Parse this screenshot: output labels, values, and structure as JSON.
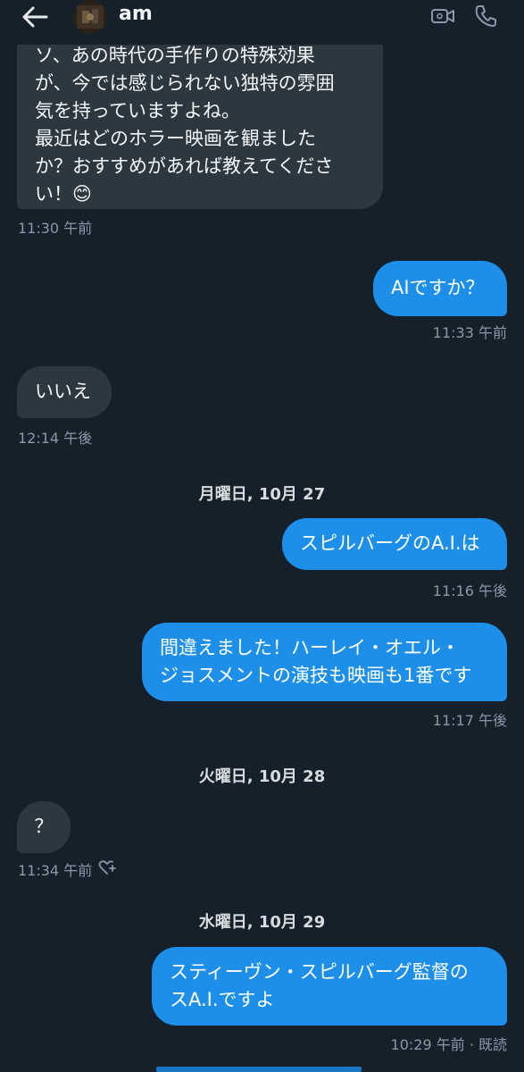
{
  "header": {
    "contact_name": "am"
  },
  "messages": [
    {
      "direction": "in",
      "text": "ソ、あの時代の手作りの特殊効果\nが、今では感じられない独特の雰囲\n気を持っていますよね。\n最近はどのホラー映画を観ました\nか？おすすめがあれば教えてくださ\nい！😊",
      "time": "11:30 午前"
    },
    {
      "direction": "out",
      "text": "AIですか？",
      "time": "11:33 午前"
    },
    {
      "direction": "in",
      "text": "いいえ",
      "time": "12:14 午後"
    },
    {
      "date_separator": "月曜日, 10月 27"
    },
    {
      "direction": "out",
      "text": "スピルバーグのA.I.は",
      "time": "11:16 午後"
    },
    {
      "direction": "out",
      "text": "間違えました！ハーレイ・オエル・\nジョスメントの演技も映画も1番です",
      "time": "11:17 午後"
    },
    {
      "date_separator": "火曜日, 10月 28"
    },
    {
      "direction": "in",
      "text": "？",
      "time": "11:34 午前"
    },
    {
      "date_separator": "水曜日, 10月 29"
    },
    {
      "direction": "out",
      "text": "スティーヴン・スピルバーグ監督の\nスA.I.ですよ",
      "time": "10:29 午前 · 既読"
    }
  ],
  "colors": {
    "background": "#15202b",
    "incoming_bubble": "#2c3740",
    "outgoing_bubble": "#1d8fe8",
    "timestamp": "#8b98a5"
  },
  "icons": [
    "back-arrow-icon",
    "video-call-icon",
    "phone-call-icon",
    "add-reaction-icon"
  ]
}
